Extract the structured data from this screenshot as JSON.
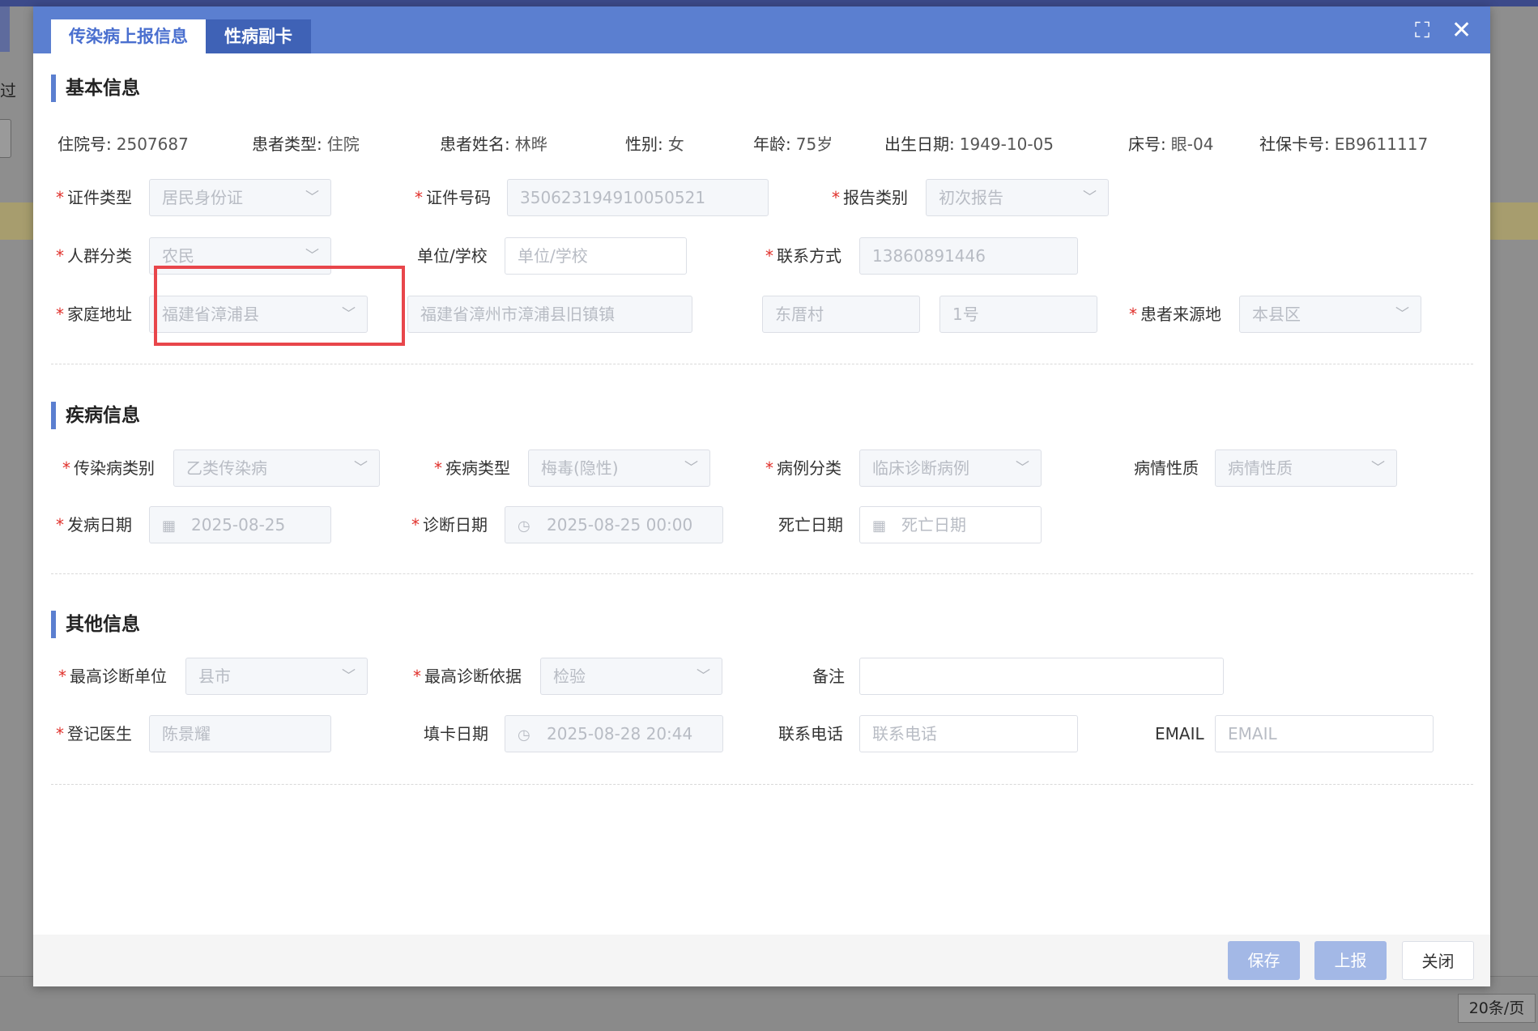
{
  "background": {
    "left_text": "过",
    "pager": "20条/页"
  },
  "tabs": [
    "传染病上报信息",
    "性病副卡"
  ],
  "header_icons": {
    "fullscreen": "fullscreen-icon",
    "close": "close-icon"
  },
  "sections": {
    "basic": "基本信息",
    "disease": "疾病信息",
    "other": "其他信息"
  },
  "patient": {
    "hospital_no_label": "住院号:",
    "hospital_no": "2507687",
    "type_label": "患者类型:",
    "type": "住院",
    "name_label": "患者姓名:",
    "name": "林晔",
    "gender_label": "性别:",
    "gender": "女",
    "age_label": "年龄:",
    "age": "75岁",
    "dob_label": "出生日期:",
    "dob": "1949-10-05",
    "bed_label": "床号:",
    "bed": "眼-04",
    "ss_label": "社保卡号:",
    "ss": "EB9611117"
  },
  "basic_fields": {
    "id_type_label": "证件类型",
    "id_type": "居民身份证",
    "id_no_label": "证件号码",
    "id_no": "350623194910050521",
    "report_type_label": "报告类别",
    "report_type": "初次报告",
    "crowd_label": "人群分类",
    "crowd": "农民",
    "unit_label": "单位/学校",
    "unit_placeholder": "单位/学校",
    "contact_label": "联系方式",
    "contact": "13860891446",
    "address_label": "家庭地址",
    "address_county": "福建省漳浦县",
    "address_town": "福建省漳州市漳浦县旧镇镇",
    "address_village": "东厝村",
    "address_no": "1号",
    "source_label": "患者来源地",
    "source": "本县区"
  },
  "disease_fields": {
    "category_label": "传染病类别",
    "category": "乙类传染病",
    "type_label": "疾病类型",
    "type": "梅毒(隐性)",
    "case_label": "病例分类",
    "case": "临床诊断病例",
    "nature_label": "病情性质",
    "nature_placeholder": "病情性质",
    "onset_label": "发病日期",
    "onset": "2025-08-25",
    "diag_label": "诊断日期",
    "diag": "2025-08-25 00:00",
    "death_label": "死亡日期",
    "death_placeholder": "死亡日期"
  },
  "other_fields": {
    "top_unit_label": "最高诊断单位",
    "top_unit": "县市",
    "top_basis_label": "最高诊断依据",
    "top_basis": "检验",
    "remark_label": "备注",
    "doctor_label": "登记医生",
    "doctor": "陈景耀",
    "fill_date_label": "填卡日期",
    "fill_date": "2025-08-28 20:44",
    "phone_label": "联系电话",
    "phone_placeholder": "联系电话",
    "email_label": "EMAIL",
    "email_placeholder": "EMAIL"
  },
  "buttons": {
    "save": "保存",
    "report": "上报",
    "close": "关闭"
  },
  "icons": {
    "select_caret": "chevron-down-icon",
    "calendar": "calendar-icon",
    "clock": "clock-icon"
  }
}
